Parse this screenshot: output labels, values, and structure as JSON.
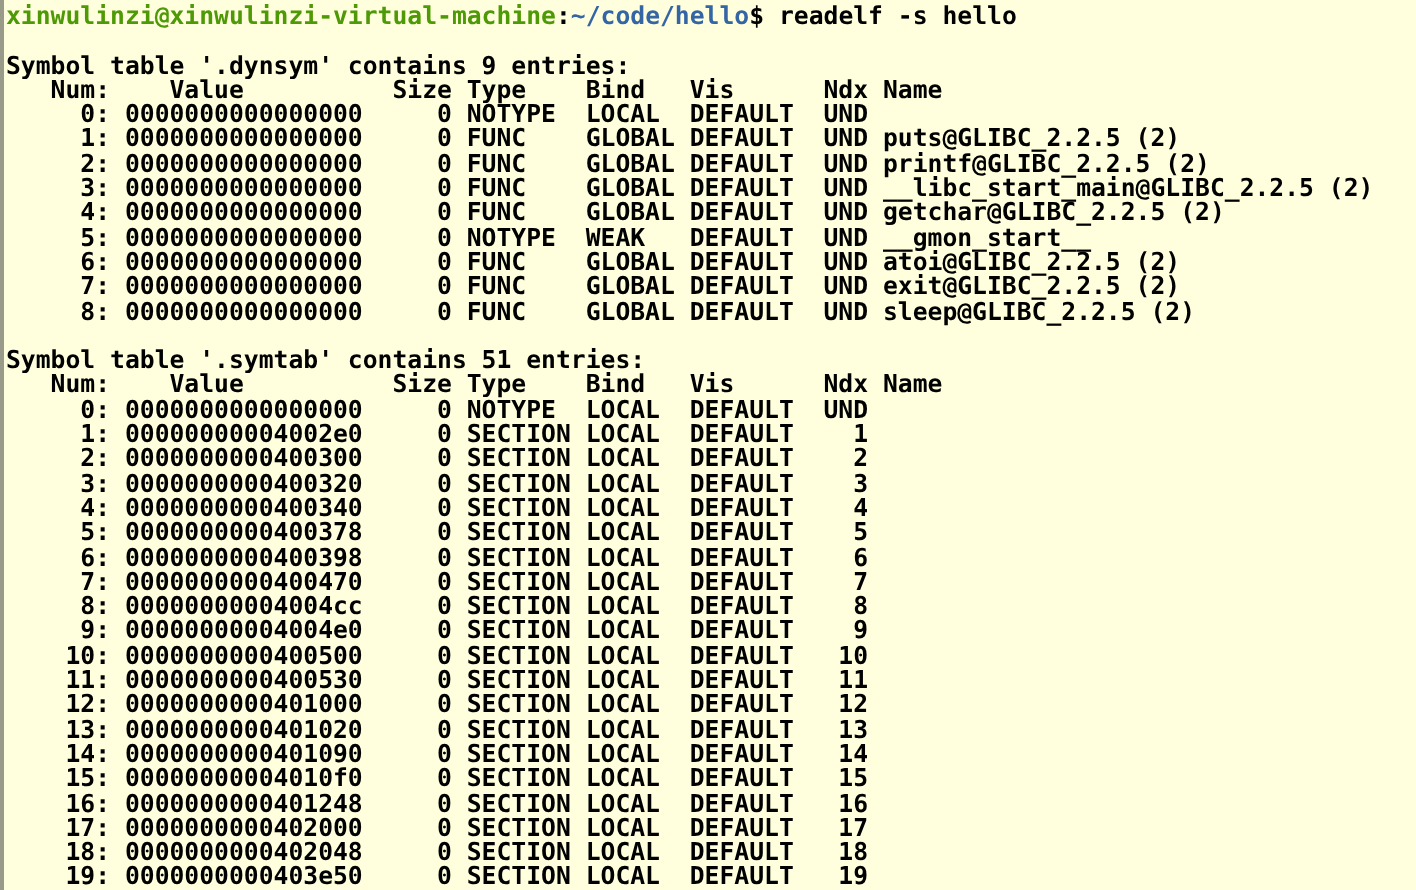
{
  "terminal": {
    "prompt": {
      "user_host": "xinwulinzi@xinwulinzi-virtual-machine",
      "separator": ":",
      "path": "~/code/hello",
      "symbol": "$",
      "command": "readelf -s hello"
    },
    "sections": [
      {
        "title": "Symbol table '.dynsym' contains 9 entries:",
        "header": "   Num:    Value          Size Type    Bind   Vis      Ndx Name",
        "rows": [
          "     0: 0000000000000000     0 NOTYPE  LOCAL  DEFAULT  UND",
          "     1: 0000000000000000     0 FUNC    GLOBAL DEFAULT  UND puts@GLIBC_2.2.5 (2)",
          "     2: 0000000000000000     0 FUNC    GLOBAL DEFAULT  UND printf@GLIBC_2.2.5 (2)",
          "     3: 0000000000000000     0 FUNC    GLOBAL DEFAULT  UND __libc_start_main@GLIBC_2.2.5 (2)",
          "     4: 0000000000000000     0 FUNC    GLOBAL DEFAULT  UND getchar@GLIBC_2.2.5 (2)",
          "     5: 0000000000000000     0 NOTYPE  WEAK   DEFAULT  UND __gmon_start__",
          "     6: 0000000000000000     0 FUNC    GLOBAL DEFAULT  UND atoi@GLIBC_2.2.5 (2)",
          "     7: 0000000000000000     0 FUNC    GLOBAL DEFAULT  UND exit@GLIBC_2.2.5 (2)",
          "     8: 0000000000000000     0 FUNC    GLOBAL DEFAULT  UND sleep@GLIBC_2.2.5 (2)"
        ]
      },
      {
        "title": "Symbol table '.symtab' contains 51 entries:",
        "header": "   Num:    Value          Size Type    Bind   Vis      Ndx Name",
        "rows": [
          "     0: 0000000000000000     0 NOTYPE  LOCAL  DEFAULT  UND",
          "     1: 00000000004002e0     0 SECTION LOCAL  DEFAULT    1",
          "     2: 0000000000400300     0 SECTION LOCAL  DEFAULT    2",
          "     3: 0000000000400320     0 SECTION LOCAL  DEFAULT    3",
          "     4: 0000000000400340     0 SECTION LOCAL  DEFAULT    4",
          "     5: 0000000000400378     0 SECTION LOCAL  DEFAULT    5",
          "     6: 0000000000400398     0 SECTION LOCAL  DEFAULT    6",
          "     7: 0000000000400470     0 SECTION LOCAL  DEFAULT    7",
          "     8: 00000000004004cc     0 SECTION LOCAL  DEFAULT    8",
          "     9: 00000000004004e0     0 SECTION LOCAL  DEFAULT    9",
          "    10: 0000000000400500     0 SECTION LOCAL  DEFAULT   10",
          "    11: 0000000000400530     0 SECTION LOCAL  DEFAULT   11",
          "    12: 0000000000401000     0 SECTION LOCAL  DEFAULT   12",
          "    13: 0000000000401020     0 SECTION LOCAL  DEFAULT   13",
          "    14: 0000000000401090     0 SECTION LOCAL  DEFAULT   14",
          "    15: 00000000004010f0     0 SECTION LOCAL  DEFAULT   15",
          "    16: 0000000000401248     0 SECTION LOCAL  DEFAULT   16",
          "    17: 0000000000402000     0 SECTION LOCAL  DEFAULT   17",
          "    18: 0000000000402048     0 SECTION LOCAL  DEFAULT   18",
          "    19: 0000000000403e50     0 SECTION LOCAL  DEFAULT   19"
        ]
      }
    ]
  }
}
